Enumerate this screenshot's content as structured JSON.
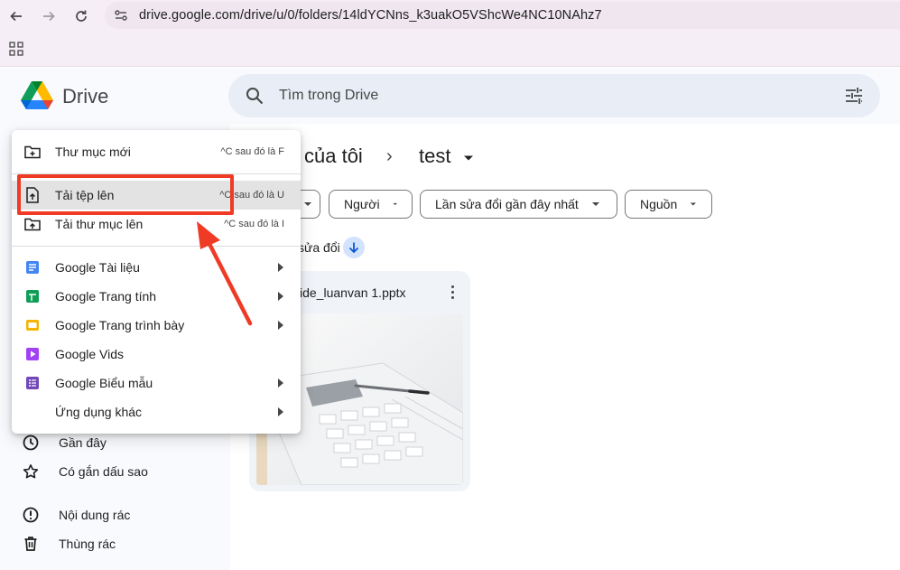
{
  "browser": {
    "url": "drive.google.com/drive/u/0/folders/14ldYCNns_k3uakO5VShcWe4NC10NAhz7"
  },
  "app": {
    "name": "Drive",
    "search_placeholder": "Tìm trong Drive"
  },
  "breadcrumb": {
    "parent": "của tôi",
    "current": "test"
  },
  "filters": [
    "Người",
    "Lần sửa đổi gần đây nhất",
    "Nguồn"
  ],
  "sort": {
    "label": "sửa đổi"
  },
  "file": {
    "name": "ide_luanvan 1.pptx"
  },
  "sidebar": {
    "items": [
      {
        "label": "Gần đây",
        "icon": "clock-icon"
      },
      {
        "label": "Có gắn dấu sao",
        "icon": "star-icon"
      },
      {
        "label": "Nội dung rác",
        "icon": "spam-icon"
      },
      {
        "label": "Thùng rác",
        "icon": "trash-icon"
      }
    ]
  },
  "menu": {
    "new_folder": {
      "label": "Thư mục mới",
      "shortcut": "^C sau đó là F"
    },
    "upload_file": {
      "label": "Tải tệp lên",
      "shortcut": "^C sau đó là U"
    },
    "upload_folder": {
      "label": "Tải thư mục lên",
      "shortcut": "^C sau đó là I"
    },
    "docs": {
      "label": "Google Tài liệu"
    },
    "sheets": {
      "label": "Google Trang tính"
    },
    "slides": {
      "label": "Google Trang trình bày"
    },
    "vids": {
      "label": "Google Vids"
    },
    "forms": {
      "label": "Google Biểu mẫu"
    },
    "more": {
      "label": "Ứng dụng khác"
    }
  },
  "colors": {
    "accent": "#0b57d0",
    "annotation": "#ef3b25",
    "docs": "#4285f4",
    "sheets": "#0f9d58",
    "slides": "#f4b400",
    "vids": "#a142f4",
    "forms": "#7248b9"
  }
}
